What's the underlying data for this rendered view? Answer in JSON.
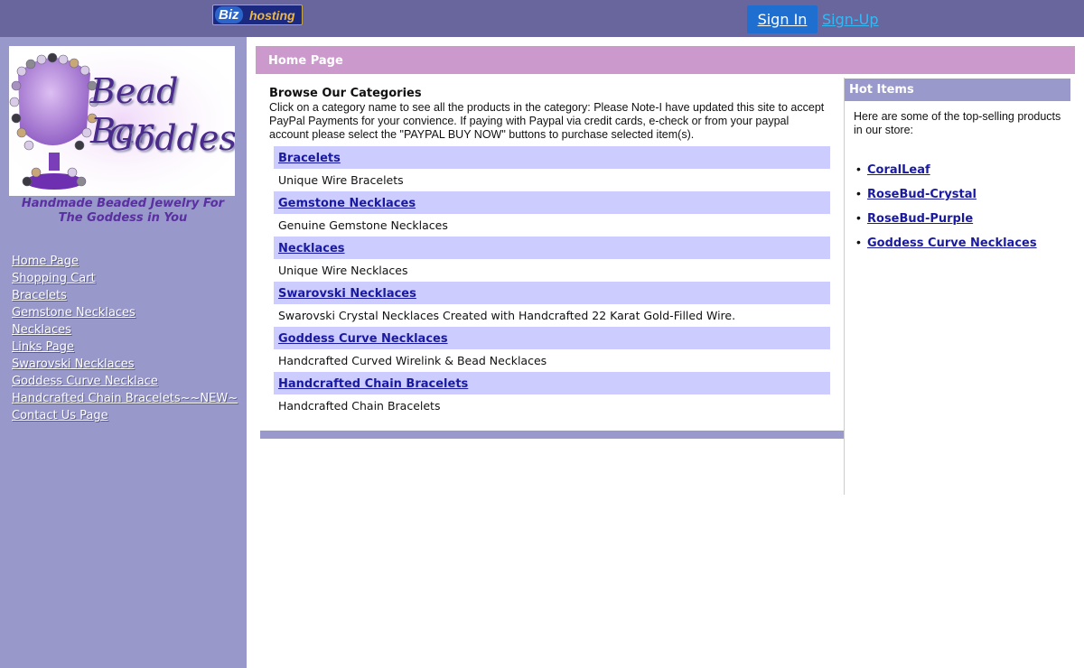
{
  "topbar": {
    "logo_biz": "Biz",
    "logo_hosting": "hosting",
    "sign_in": "Sign In",
    "sign_up": "Sign-Up"
  },
  "sidebar": {
    "brand_line1": "Bead Bar",
    "brand_line2": "Goddess",
    "tagline": "Handmade Beaded Jewelry For The Goddess in You",
    "nav": [
      {
        "label": "Home Page"
      },
      {
        "label": "Shopping Cart"
      },
      {
        "label": "Bracelets"
      },
      {
        "label": "Gemstone Necklaces"
      },
      {
        "label": "Necklaces"
      },
      {
        "label": "Links Page"
      },
      {
        "label": "Swarovski Necklaces"
      },
      {
        "label": "Goddess Curve Necklace"
      },
      {
        "label": "Handcrafted Chain Bracelets~~NEW~"
      },
      {
        "label": "Contact Us Page"
      }
    ]
  },
  "main": {
    "header": "Home Page",
    "heading": "Browse Our Categories",
    "intro": "Click on a category name to see all the products in the category: Please Note-I have updated this site to accept PayPal Payments for your convience. If paying with Paypal via credit cards, e-check or from your paypal account please select the \"PAYPAL BUY NOW\" buttons to purchase selected item(s).",
    "categories": [
      {
        "name": "Bracelets",
        "description": "Unique Wire Bracelets"
      },
      {
        "name": "Gemstone Necklaces",
        "description": "Genuine Gemstone Necklaces"
      },
      {
        "name": "Necklaces",
        "description": "Unique Wire Necklaces"
      },
      {
        "name": "Swarovski Necklaces",
        "description": "Swarovski Crystal Necklaces Created with Handcrafted 22 Karat Gold-Filled Wire."
      },
      {
        "name": "Goddess Curve Necklaces",
        "description": "Handcrafted Curved Wirelink & Bead Necklaces"
      },
      {
        "name": "Handcrafted Chain Bracelets",
        "description": "Handcrafted Chain Bracelets"
      }
    ]
  },
  "hot_items": {
    "header": "Hot Items",
    "intro": "Here are some of the top-selling products in our store:",
    "items": [
      {
        "label": "CoralLeaf"
      },
      {
        "label": "RoseBud-Crystal"
      },
      {
        "label": "RoseBud-Purple"
      },
      {
        "label": "Goddess Curve Necklaces"
      }
    ]
  },
  "colors": {
    "topbar": "#68669c",
    "sidebar": "#9898cb",
    "page_header": "#cc99cc",
    "category_row": "#ccccff",
    "hot_header": "#9999cc",
    "link": "#1a1aa0",
    "sign_in_button": "#1f6fd0",
    "sign_up_link": "#35b9f5"
  }
}
